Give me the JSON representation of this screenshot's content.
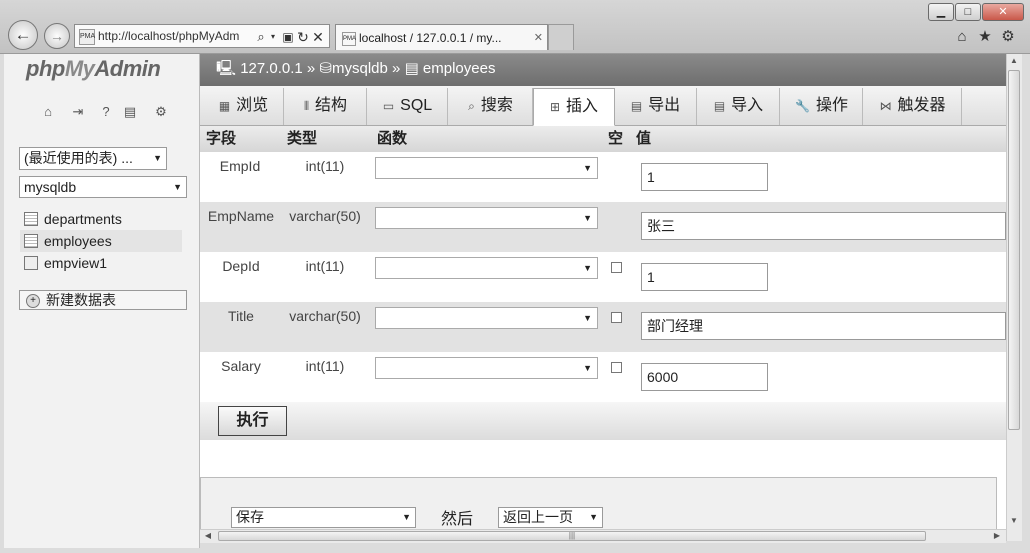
{
  "browser": {
    "address": "http://localhost/phpMyAdm",
    "favicon_text": "PMA",
    "tab_title": "localhost / 127.0.0.1 / my...",
    "window_buttons": [
      "▁",
      "□",
      "✕"
    ]
  },
  "sidebar": {
    "logo_php": "php",
    "logo_my": "My",
    "logo_admin": "Admin",
    "recent_tables": "(最近使用的表) ...",
    "database": "mysqldb",
    "tables": [
      "departments",
      "employees",
      "empview1"
    ],
    "new_table": "新建数据表"
  },
  "breadcrumb": {
    "server": "127.0.0.1",
    "database": "mysqldb",
    "table": "employees",
    "sep": "»"
  },
  "tabs": [
    "浏览",
    "结构",
    "SQL",
    "搜索",
    "插入",
    "导出",
    "导入",
    "操作",
    "触发器"
  ],
  "active_tab": "插入",
  "headers": {
    "field": "字段",
    "type": "类型",
    "function": "函数",
    "null": "空",
    "value": "值"
  },
  "rows": [
    {
      "field": "EmpId",
      "type": "int(11)",
      "value": "1",
      "nullable": false
    },
    {
      "field": "EmpName",
      "type": "varchar(50)",
      "value": "张三",
      "nullable": false
    },
    {
      "field": "DepId",
      "type": "int(11)",
      "value": "1",
      "nullable": true
    },
    {
      "field": "Title",
      "type": "varchar(50)",
      "value": "部门经理",
      "nullable": true
    },
    {
      "field": "Salary",
      "type": "int(11)",
      "value": "6000",
      "nullable": true
    }
  ],
  "execute_label": "执行",
  "bottom": {
    "action": "保存",
    "then_label": "然后",
    "after": "返回上一页"
  }
}
